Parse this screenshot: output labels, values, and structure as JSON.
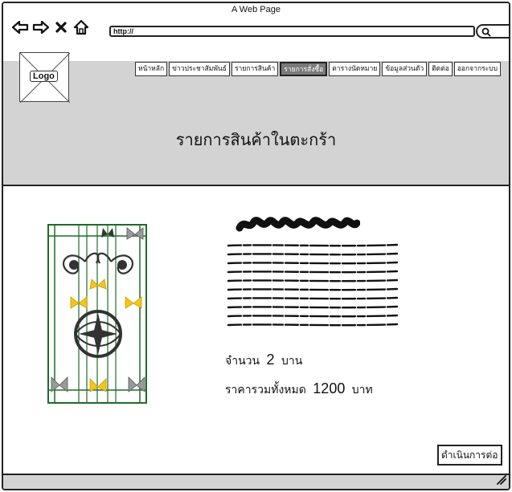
{
  "window": {
    "title": "A Web Page"
  },
  "browser": {
    "url": "http://"
  },
  "header": {
    "logo_label": "Logo",
    "page_title": "รายการสินค้าในตะกร้า"
  },
  "menu": {
    "items": [
      {
        "label": "หน้าหลัก"
      },
      {
        "label": "ข่าวประชาสัมพันธ์"
      },
      {
        "label": "รายการสินค้า"
      },
      {
        "label": "รายการสั่งซื้อ",
        "active": true
      },
      {
        "label": "ตารางนัดหมาย"
      },
      {
        "label": "ข้อมูลส่วนตัว"
      },
      {
        "label": "ติดต่อ"
      },
      {
        "label": "ออกจากระบบ"
      }
    ]
  },
  "product": {
    "qty_label": "จำนวน",
    "qty_value": "2",
    "qty_unit": "บาน",
    "total_label": "ราคารวมทั้งหมด",
    "total_value": "1200",
    "total_unit": "บาท"
  },
  "actions": {
    "continue_label": "ดำเนินการต่อ"
  },
  "icons": {
    "back": "arrow-left-icon",
    "forward": "arrow-right-icon",
    "stop": "close-icon",
    "home": "home-icon",
    "search": "search-icon",
    "logo_placeholder": "image-placeholder-icon"
  },
  "colors": {
    "header_bg": "#d3d3d3",
    "active_menu_bg": "#7a7a7a",
    "frame_green": "#1f6b2a",
    "butterfly_yellow": "#f5c518"
  }
}
